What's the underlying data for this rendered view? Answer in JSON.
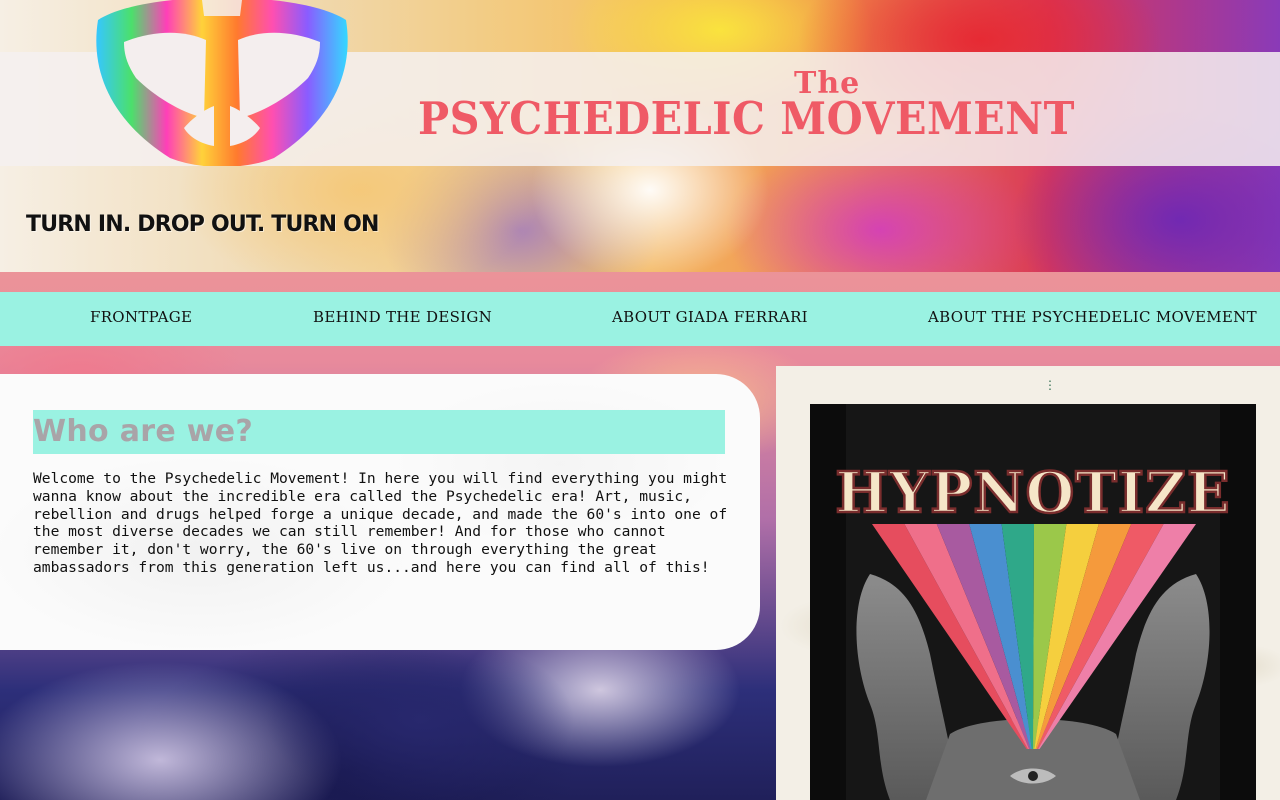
{
  "header": {
    "title_small": "The",
    "title_main": "PSYCHEDELIC MOVEMENT",
    "tagline": "TURN IN. DROP OUT. TURN ON",
    "logo_icon": "rainbow-peace-sign-icon"
  },
  "nav": {
    "items": [
      {
        "label": "FRONTPAGE"
      },
      {
        "label": "BEHIND THE DESIGN"
      },
      {
        "label": "ABOUT GIADA FERRARI"
      },
      {
        "label": "ABOUT THE PSYCHEDELIC MOVEMENT"
      }
    ]
  },
  "intro": {
    "heading": "Who are we?",
    "body": "Welcome to the Psychedelic Movement! In here you will find everything you might wanna know about the incredible era called the Psychedelic era! Art, music, rebellion and drugs helped forge a unique decade, and made the 60's into one of the most diverse decades we can still remember! And for those who cannot remember it, don't worry, the 60's live on through everything the great ambassadors from this generation left us...and here you can find all of this!"
  },
  "poster": {
    "title": "HYPNOTIZE",
    "rainbow_colors": [
      "#e64d5e",
      "#ef6f8a",
      "#a85aa0",
      "#4a8fd0",
      "#2fa889",
      "#9bc84a",
      "#f5cf3e",
      "#f59a3c",
      "#ef5a66",
      "#ee7fa8"
    ]
  },
  "colors": {
    "accent_teal": "#9af2e2",
    "title_coral": "#ef5a66",
    "heading_grey": "#a9a4a8"
  }
}
